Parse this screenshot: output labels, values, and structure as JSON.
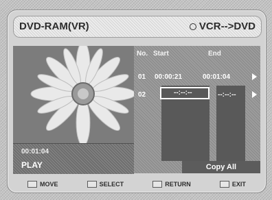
{
  "header": {
    "title": "DVD-RAM(VR)",
    "mode": "VCR-->DVD",
    "mode_icon": "circle-icon"
  },
  "preview": {
    "time": "00:01:04",
    "state": "PLAY"
  },
  "list": {
    "col_no": "No.",
    "col_start": "Start",
    "col_end": "End",
    "rows": [
      {
        "no": "01",
        "start": "00:00:21",
        "end": "00:01:04"
      },
      {
        "no": "02",
        "start": "--:--:--",
        "end": "--:--:--"
      }
    ],
    "action": "Copy All"
  },
  "footer": {
    "items": [
      {
        "label": "MOVE",
        "icon": "move-button-icon"
      },
      {
        "label": "SELECT",
        "icon": "enter-button-icon"
      },
      {
        "label": "RETURN",
        "icon": "return-button-icon"
      },
      {
        "label": "EXIT",
        "icon": "exit-button-icon"
      }
    ]
  }
}
